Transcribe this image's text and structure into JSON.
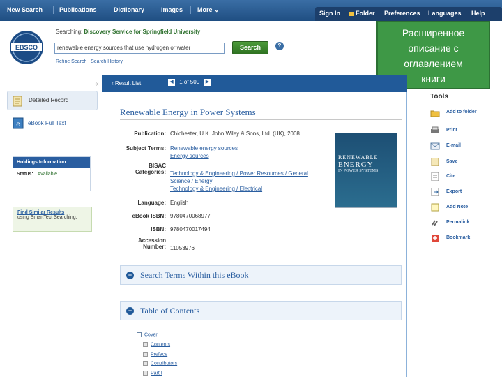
{
  "topnav": {
    "left": [
      "New Search",
      "Publications",
      "Dictionary",
      "Images",
      "More ⌄"
    ],
    "right": [
      "Sign In",
      "Folder",
      "Preferences",
      "Languages",
      "Help"
    ]
  },
  "search": {
    "searching_prefix": "Searching:",
    "database": "Discovery Service for Springfield University",
    "query": "renewable energy sources that use hydrogen or water",
    "button": "Search",
    "help": "?",
    "links": [
      "Refine Search",
      "Search History"
    ]
  },
  "callout": {
    "lines": [
      "Расширенное",
      "описание с",
      "оглавлением",
      "книги"
    ]
  },
  "left": {
    "collapse": "«",
    "detailed_record": "Detailed Record",
    "ebook": "eBook Full Text",
    "holdings_title": "Holdings Information",
    "status_label": "Status:",
    "status_value": "Available",
    "similar_link": "Find Similar Results",
    "similar_sub": "using SmartText Searching."
  },
  "resultbar": {
    "result_list": "‹ Result List",
    "prev": "◀",
    "pager": "1 of 500",
    "next": "▶"
  },
  "record": {
    "title": "Renewable Energy in Power Systems",
    "pub_label": "Publication:",
    "pub": "Chichester, U.K. John Wiley & Sons, Ltd. (UK), 2008",
    "subj_label": "Subject Terms:",
    "subj1": "Renewable energy sources",
    "subj2": "Energy sources",
    "bisac_label1": "BISAC",
    "bisac_label2": "Categories:",
    "bisac1": "Technology & Engineering / Power Resources / General",
    "bisac2": "Science / Energy",
    "bisac3": "Technology & Engineering / Electrical",
    "lang_label": "Language:",
    "lang": "English",
    "ebook_isbn_label": "eBook ISBN:",
    "ebook_isbn": "9780470068977",
    "isbn_label": "ISBN:",
    "isbn": "9780470017494",
    "acc_label1": "Accession",
    "acc_label2": "Number:",
    "acc": "11053976",
    "cover_line1": "RENEWABLE",
    "cover_line2": "ENERGY",
    "cover_line3": "IN POWER SYSTEMS"
  },
  "panels": {
    "search_terms": "Search Terms Within this eBook",
    "toc": "Table of Contents",
    "plus": "+",
    "minus": "−"
  },
  "toc": {
    "cover": "Cover",
    "items": [
      "Contents",
      "Preface",
      "Contributors",
      "Part I"
    ]
  },
  "tools": {
    "title": "Tools",
    "items": [
      "Add to folder",
      "Print",
      "E-mail",
      "Save",
      "Cite",
      "Export",
      "Add Note",
      "Permalink",
      "Bookmark"
    ]
  },
  "colors": {
    "nav": "#1f4e82",
    "accent": "#2a5ea0",
    "callout": "#3e9846"
  }
}
